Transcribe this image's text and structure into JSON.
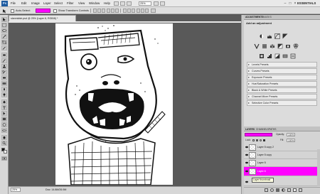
{
  "app": {
    "logo": "Ps"
  },
  "menubar": {
    "items": [
      "File",
      "Edit",
      "Image",
      "Layer",
      "Select",
      "Filter",
      "View",
      "Window",
      "Help"
    ],
    "zoom": "25%",
    "workspace": "ESSENTIALS",
    "window_controls": [
      "–",
      "□",
      "×"
    ]
  },
  "options_bar": {
    "auto_select_label": "Auto-Select:",
    "auto_select_value": "",
    "show_transform_label": "Show Transform Controls",
    "accent": "#ff00ff"
  },
  "document": {
    "tab_title": "slanmidstr.psd @ 25% (Layer 6, RGB/8) *",
    "status_zoom": "25%",
    "status_doc": "Doc: 14.8M/26.9M"
  },
  "adjustments": {
    "tabs": [
      "ADJUSTMENTS",
      "MASKS"
    ],
    "title": "Add an adjustment",
    "icons": [
      "brightness-icon",
      "levels-icon",
      "curves-icon",
      "exposure-icon",
      "vibrance-icon",
      "hue-saturation-icon",
      "color-balance-icon",
      "black-white-icon",
      "photo-filter-icon",
      "channel-mixer-icon",
      "invert-icon",
      "posterize-icon",
      "threshold-icon",
      "gradient-map-icon",
      "selective-color-icon"
    ],
    "presets": [
      "Levels Presets",
      "Curves Presets",
      "Exposure Presets",
      "Hue/Saturation Presets",
      "Black & White Presets",
      "Channel Mixer Presets",
      "Selective Color Presets"
    ]
  },
  "layers": {
    "tabs": [
      "LAYERS",
      "CHANNELS",
      "PATHS"
    ],
    "blend_mode": "",
    "opacity_label": "Opacity:",
    "opacity_value": "100%",
    "lock_label": "Lock:",
    "fill_label": "Fill:",
    "fill_value": "100%",
    "items": [
      {
        "name": "Layer 5 copy 2",
        "selected": false
      },
      {
        "name": "Layer 5 copy",
        "selected": false
      },
      {
        "name": "Layer 5",
        "selected": false
      },
      {
        "name": "Layer 6",
        "selected": true
      },
      {
        "name": "",
        "selected": false
      }
    ],
    "tooltip": "Layer thumbnail",
    "selection_color": "#ff00ff"
  }
}
